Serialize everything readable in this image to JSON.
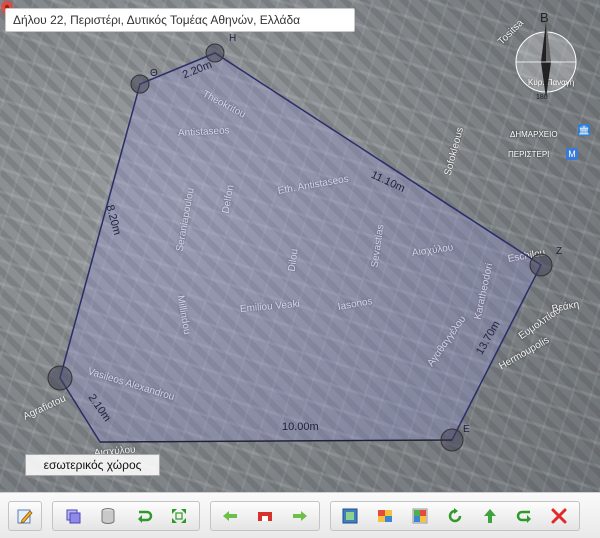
{
  "address": {
    "value": "Δήλου 22, Περιστέρι, Δυτικός Τομέας Αθηνών, Ελλάδα"
  },
  "compass": {
    "north_label": "B",
    "angle_text": "180"
  },
  "polygon": {
    "vertices": [
      "H",
      "Θ",
      "Z",
      "E"
    ],
    "dimensions": [
      "2.20m",
      "11.10m",
      "8.20m",
      "13.70m",
      "10.00m",
      "2.10m"
    ],
    "area_label": "εσωτερικός χώρος",
    "stroke_color": "#2a2d6a",
    "fill_color": "rgba(150,150,215,0.32)"
  },
  "map": {
    "roads": [
      "Theokritou",
      "Antistaseos",
      "Eth. Antistaseos",
      "Seraniapoulou",
      "Delfon",
      "Millindou",
      "Sevastias",
      "Αισχύλου",
      "Emiliou Veaki",
      "Iasonos",
      "Dilou",
      "Vasileos Alexandrou",
      "Agrafiotou",
      "Hermoupolis",
      "Eschilou",
      "Karatheodori",
      "Sofokleous",
      "Tositsa",
      "Αγαθαγγέλου",
      "Ευμολπίου",
      "Βεάκη",
      "Αισχύλου"
    ],
    "pois": [
      "ΔΗΜΑΡΧΕΙΟ",
      "ΠΕΡΙΣΤΕΡΙ",
      "Κυρ. Παναγή"
    ]
  },
  "toolbar": {
    "buttons": [
      {
        "name": "edit-button",
        "icon": "pencil-icon"
      },
      {
        "name": "layers-button",
        "icon": "layers-icon"
      },
      {
        "name": "database-button",
        "icon": "cylinder-icon"
      },
      {
        "name": "undo-button",
        "icon": "undo-arrow-icon"
      },
      {
        "name": "fullscreen-button",
        "icon": "expand-icon"
      },
      {
        "name": "back-button",
        "icon": "arrow-left-icon"
      },
      {
        "name": "shape-button",
        "icon": "rectangle-icon"
      },
      {
        "name": "forward-button",
        "icon": "arrow-right-icon"
      },
      {
        "name": "map-view-button",
        "icon": "map-icon"
      },
      {
        "name": "marker-button",
        "icon": "marker-icon"
      },
      {
        "name": "google-maps-button",
        "icon": "maps-icon"
      },
      {
        "name": "refresh-button",
        "icon": "refresh-icon"
      },
      {
        "name": "upload-button",
        "icon": "arrow-up-icon"
      },
      {
        "name": "redo-button",
        "icon": "redo-arrow-icon"
      },
      {
        "name": "delete-button",
        "icon": "close-icon"
      }
    ]
  }
}
